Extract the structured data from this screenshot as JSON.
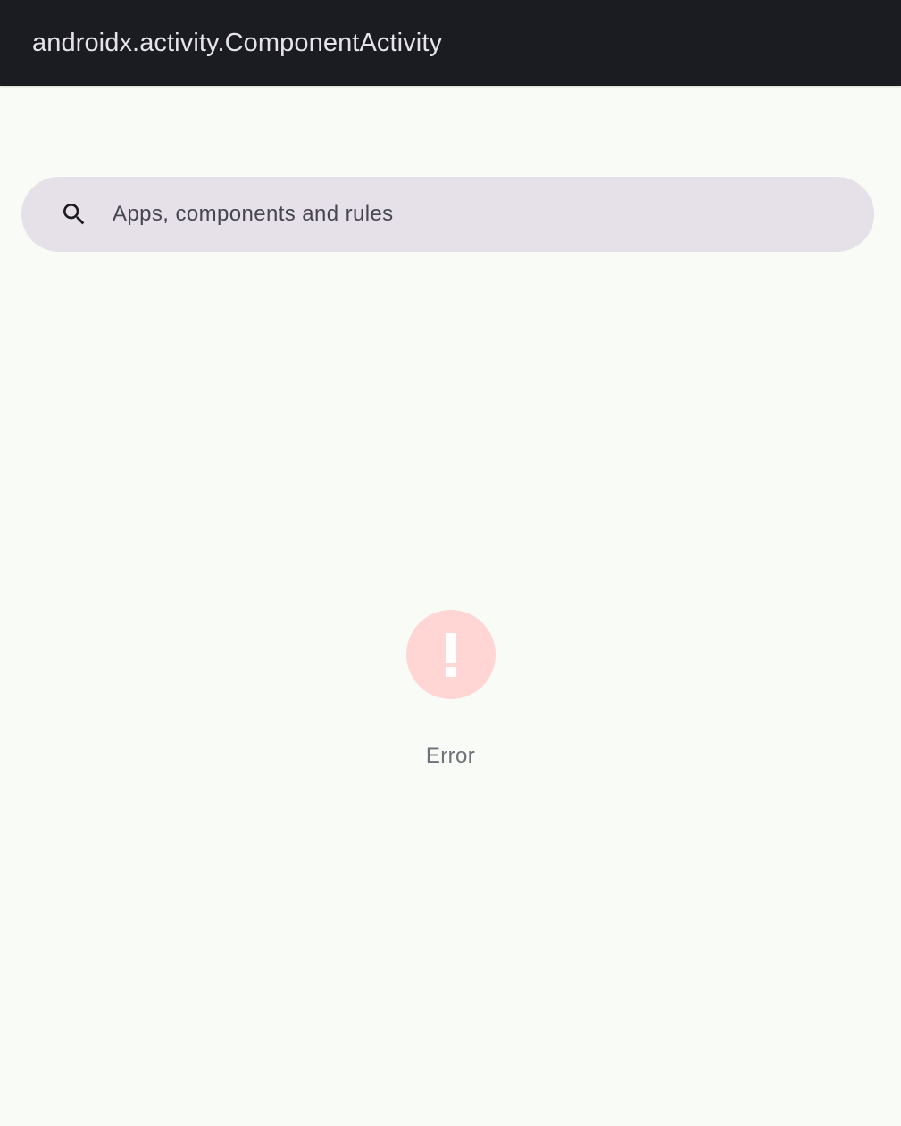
{
  "app_bar": {
    "title": "androidx.activity.ComponentActivity"
  },
  "search": {
    "icon": "search-icon",
    "placeholder": "Apps, components and rules",
    "value": ""
  },
  "error_state": {
    "icon": "error-exclamation-icon",
    "label": "Error"
  },
  "colors": {
    "app_bar_background": "#1b1c21",
    "page_background": "#f9fbf6",
    "search_background": "#e6e0e8",
    "error_icon_background": "#ffd6d4"
  }
}
